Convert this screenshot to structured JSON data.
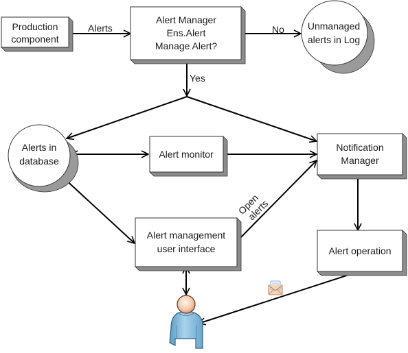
{
  "diagram": {
    "type": "flowchart",
    "colors": {
      "box_fill": "#ffffff",
      "box_shadow": "#8c8c8c",
      "circle_shadow": "#9a9a9a",
      "line": "#000000",
      "text": "#1a1a1a"
    },
    "nodes": {
      "production": {
        "shape": "box",
        "lines": [
          "Production",
          "component"
        ]
      },
      "alert_manager": {
        "shape": "box",
        "lines": [
          "Alert Manager",
          "Ens.Alert",
          "Manage Alert?"
        ]
      },
      "unmanaged_log": {
        "shape": "circle",
        "lines": [
          "Unmanaged",
          "alerts in Log"
        ]
      },
      "alerts_db": {
        "shape": "circle",
        "lines": [
          "Alerts in",
          "database"
        ]
      },
      "alert_monitor": {
        "shape": "box",
        "lines": [
          "Alert monitor"
        ]
      },
      "notification_manager": {
        "shape": "box",
        "lines": [
          "Notification",
          "Manager"
        ]
      },
      "alert_mgmt_ui": {
        "shape": "box",
        "lines": [
          "Alert management",
          "user interface"
        ]
      },
      "alert_operation": {
        "shape": "box",
        "lines": [
          "Alert operation"
        ]
      },
      "user": {
        "shape": "person-icon",
        "lines": []
      },
      "email": {
        "shape": "envelope-icon",
        "lines": []
      }
    },
    "edges": [
      {
        "from": "production",
        "to": "alert_manager",
        "label": "Alerts"
      },
      {
        "from": "alert_manager",
        "to": "unmanaged_log",
        "label": "No"
      },
      {
        "from": "alert_manager",
        "to": "junction",
        "label": "Yes"
      },
      {
        "from": "junction",
        "to": "alerts_db",
        "label": ""
      },
      {
        "from": "junction",
        "to": "notification_manager",
        "label": ""
      },
      {
        "from": "alerts_db",
        "to": "alert_monitor",
        "label": "",
        "bidirectional": true
      },
      {
        "from": "alert_monitor",
        "to": "notification_manager",
        "label": ""
      },
      {
        "from": "alerts_db",
        "to": "alert_mgmt_ui",
        "label": "",
        "bidirectional": true
      },
      {
        "from": "alert_mgmt_ui",
        "to": "notification_manager",
        "label": "Open alerts"
      },
      {
        "from": "notification_manager",
        "to": "alert_operation",
        "label": ""
      },
      {
        "from": "alert_mgmt_ui",
        "to": "user",
        "label": "",
        "bidirectional": true
      },
      {
        "from": "alert_operation",
        "to": "user",
        "label": ""
      }
    ],
    "labels": {
      "alerts": "Alerts",
      "no": "No",
      "yes": "Yes",
      "open": "Open",
      "alerts_rot": "alerts"
    }
  }
}
